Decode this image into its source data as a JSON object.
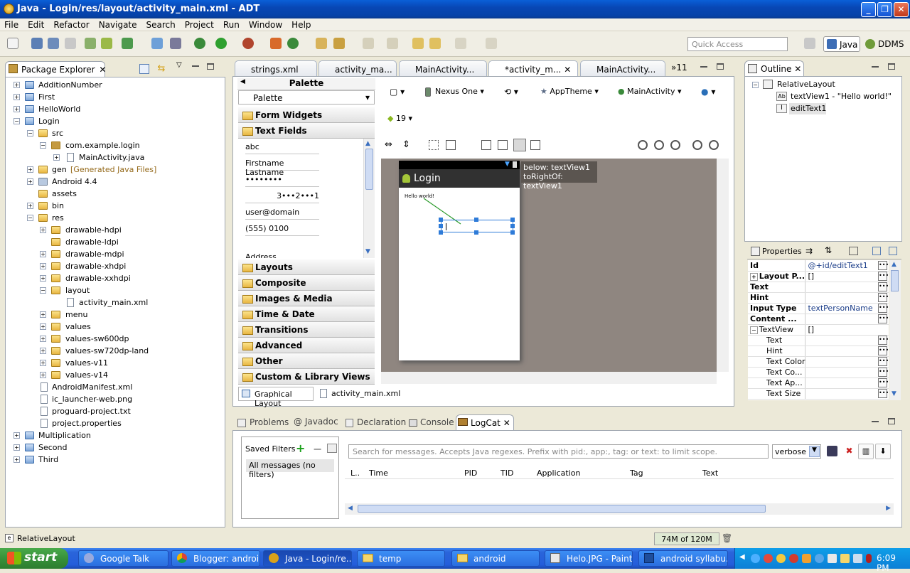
{
  "window": {
    "title": "Java - Login/res/layout/activity_main.xml - ADT"
  },
  "menu": [
    "File",
    "Edit",
    "Refactor",
    "Navigate",
    "Search",
    "Project",
    "Run",
    "Window",
    "Help"
  ],
  "toolbar": {
    "quick_access_placeholder": "Quick Access",
    "perspective_java": "Java",
    "perspective_ddms": "DDMS"
  },
  "package_explorer": {
    "title": "Package Explorer",
    "items": [
      {
        "label": "AdditionNumber"
      },
      {
        "label": "First"
      },
      {
        "label": "HelloWorld"
      },
      {
        "label": "Login"
      },
      {
        "label": "src"
      },
      {
        "label": "com.example.login"
      },
      {
        "label": "MainActivity.java"
      },
      {
        "label": "gen",
        "suffix": "[Generated Java Files]"
      },
      {
        "label": "Android 4.4"
      },
      {
        "label": "assets"
      },
      {
        "label": "bin"
      },
      {
        "label": "res"
      },
      {
        "label": "drawable-hdpi"
      },
      {
        "label": "drawable-ldpi"
      },
      {
        "label": "drawable-mdpi"
      },
      {
        "label": "drawable-xhdpi"
      },
      {
        "label": "drawable-xxhdpi"
      },
      {
        "label": "layout"
      },
      {
        "label": "activity_main.xml"
      },
      {
        "label": "menu"
      },
      {
        "label": "values"
      },
      {
        "label": "values-sw600dp"
      },
      {
        "label": "values-sw720dp-land"
      },
      {
        "label": "values-v11"
      },
      {
        "label": "values-v14"
      },
      {
        "label": "AndroidManifest.xml"
      },
      {
        "label": "ic_launcher-web.png"
      },
      {
        "label": "proguard-project.txt"
      },
      {
        "label": "project.properties"
      },
      {
        "label": "Multiplication"
      },
      {
        "label": "Second"
      },
      {
        "label": "Third"
      }
    ]
  },
  "editor_tabs": [
    {
      "label": "strings.xml"
    },
    {
      "label": "activity_ma..."
    },
    {
      "label": "MainActivity..."
    },
    {
      "label": "*activity_m..."
    },
    {
      "label": "MainActivity..."
    },
    {
      "label": "»11"
    }
  ],
  "palette": {
    "header": "Palette",
    "dropdown": "Palette",
    "categories_top": [
      "Form Widgets",
      "Text Fields"
    ],
    "text_fields": [
      "abc",
      "Firstname Lastname",
      "••••••••",
      "3•••2•••1",
      "user@domain",
      "(555) 0100",
      "Address"
    ],
    "categories_bottom": [
      "Layouts",
      "Composite",
      "Images & Media",
      "Time & Date",
      "Transitions",
      "Advanced",
      "Other",
      "Custom & Library Views"
    ]
  },
  "layout_toolbar": {
    "device": "Nexus One",
    "theme": "AppTheme",
    "activity": "MainActivity",
    "api": "19"
  },
  "device_preview": {
    "app_title": "Login",
    "hello_text": "Hello world!",
    "tooltip_line1": "below: textView1",
    "tooltip_line2": "toRightOf: textView1"
  },
  "bottom_tabs": {
    "graphical": "Graphical Layout",
    "xml": "activity_main.xml"
  },
  "outline": {
    "title": "Outline",
    "root": "RelativeLayout",
    "child1": "textView1 - \"Hello world!\"",
    "child2": "editText1"
  },
  "properties": {
    "title": "Properties",
    "rows": [
      {
        "name": "Id",
        "value": "@+id/editText1"
      },
      {
        "name": "Layout P...",
        "value": "[]"
      },
      {
        "name": "Text",
        "value": ""
      },
      {
        "name": "Hint",
        "value": ""
      },
      {
        "name": "Input Type",
        "value": "textPersonName"
      },
      {
        "name": "Content ...",
        "value": ""
      },
      {
        "name": "TextView",
        "value": "[]"
      },
      {
        "name": "Text",
        "value": ""
      },
      {
        "name": "Hint",
        "value": ""
      },
      {
        "name": "Text Color",
        "value": ""
      },
      {
        "name": "Text Co...",
        "value": ""
      },
      {
        "name": "Text Ap...",
        "value": ""
      },
      {
        "name": "Text Size",
        "value": ""
      }
    ]
  },
  "bottom_views": {
    "tabs": [
      "Problems",
      "Javadoc",
      "Declaration",
      "Console",
      "LogCat"
    ],
    "saved_filters": "Saved Filters",
    "all_messages": "All messages (no filters)",
    "search_placeholder": "Search for messages. Accepts Java regexes. Prefix with pid:, app:, tag: or text: to limit scope.",
    "level": "verbose",
    "columns": [
      "L..",
      "Time",
      "PID",
      "TID",
      "Application",
      "Tag",
      "Text"
    ]
  },
  "status": {
    "left": "RelativeLayout",
    "memory": "74M of 120M"
  },
  "taskbar": {
    "start": "start",
    "tasks": [
      "Google Talk",
      "Blogger: androi...",
      "Java - Login/re...",
      "temp",
      "android",
      "Helo.JPG - Paint",
      "android syllabu..."
    ],
    "clock": "6:09 PM"
  }
}
